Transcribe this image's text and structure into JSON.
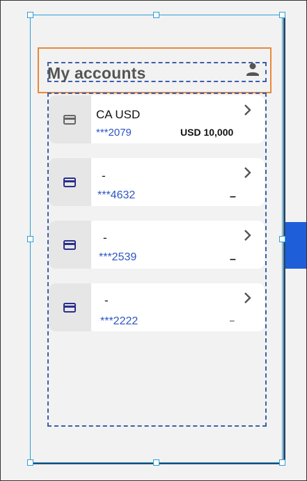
{
  "header": {
    "title": "My accounts"
  },
  "accounts": [
    {
      "name": "CA USD",
      "number": "***2079",
      "balance": "USD 10,000"
    },
    {
      "name": "-",
      "number": "***4632",
      "balance": "–"
    },
    {
      "name": "-",
      "number": "***2539",
      "balance": "–"
    },
    {
      "name": "-",
      "number": "***2222",
      "balance": "–"
    }
  ],
  "colors": {
    "accent": "#2d55c2",
    "selection": "#2b9fd8",
    "highlight": "#e8893a",
    "tab": "#1e5fd9"
  },
  "icons": {
    "profile": "person-icon",
    "card": "credit-card-icon",
    "chevron": "chevron-right-icon"
  }
}
